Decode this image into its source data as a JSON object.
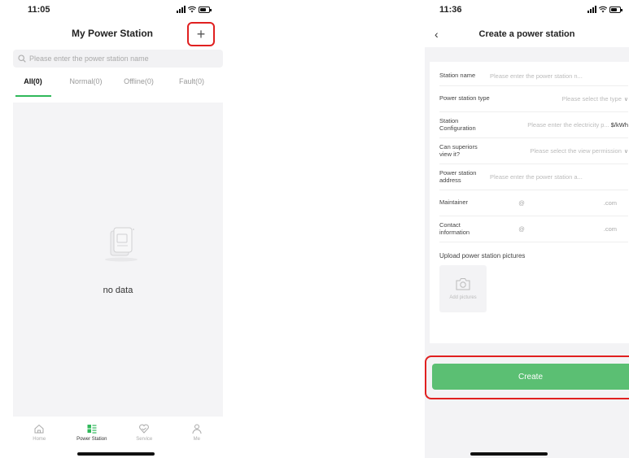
{
  "left": {
    "time": "11:05",
    "title": "My Power Station",
    "add_glyph": "+",
    "search_placeholder": "Please enter the power station name",
    "tabs": [
      {
        "label": "All(0)"
      },
      {
        "label": "Normal(0)"
      },
      {
        "label": "Offline(0)"
      },
      {
        "label": "Fault(0)"
      }
    ],
    "empty_text": "no data",
    "tabbar": [
      {
        "label": "Home",
        "icon": "home-icon"
      },
      {
        "label": "Power Station",
        "icon": "power-station-icon"
      },
      {
        "label": "Service",
        "icon": "service-icon"
      },
      {
        "label": "Me",
        "icon": "user-icon"
      }
    ]
  },
  "right": {
    "time": "11:36",
    "back_glyph": "‹",
    "title": "Create a power station",
    "fields": {
      "name": {
        "label": "Station name",
        "placeholder": "Please enter the power station n..."
      },
      "type": {
        "label": "Power station type",
        "placeholder": "Please select the type"
      },
      "config": {
        "label": "Station Configuration",
        "placeholder": "Please enter the electricity p...",
        "unit": "$/kWh"
      },
      "superiors": {
        "label": "Can superiors view it?",
        "placeholder": "Please select the view permission"
      },
      "address": {
        "label": "Power station address",
        "placeholder": "Please enter the power station a..."
      },
      "maintainer": {
        "label": "Maintainer",
        "at": "@",
        "domain": ".com"
      },
      "contact": {
        "label": "Contact information",
        "at": "@",
        "domain": ".com"
      }
    },
    "upload_label": "Upload power station pictures",
    "add_pictures": "Add pictures",
    "create_label": "Create"
  },
  "colors": {
    "accent": "#2fb85a",
    "button": "#5bbf73",
    "highlight": "#e02020"
  }
}
